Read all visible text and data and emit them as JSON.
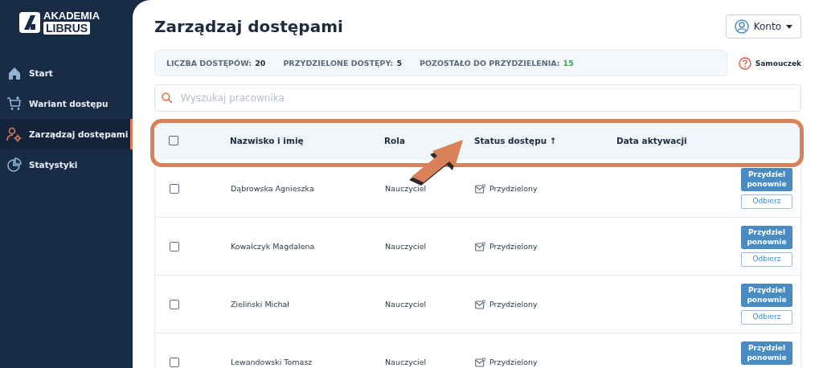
{
  "logo": {
    "line_1": "AKADEMIA",
    "line_2": "LIBRUS"
  },
  "sidebar": {
    "items": [
      {
        "label": "Start",
        "kind": "home",
        "selected": false
      },
      {
        "label": "Wariant dostępu",
        "kind": "cart",
        "selected": false
      },
      {
        "label": "Zarządzaj dostępami",
        "kind": "users",
        "selected": true
      },
      {
        "label": "Statystyki",
        "kind": "pie",
        "selected": false
      }
    ]
  },
  "page_title": "Zarządzaj dostępami",
  "account_button": "Konto",
  "stats": [
    {
      "label": "LICZBA DOSTĘPÓW:",
      "value": "20",
      "color": "#1c2b3e"
    },
    {
      "label": "PRZYDZIELONE DOSTĘPY:",
      "value": "5",
      "color": "#1c2b3e"
    },
    {
      "label": "POZOSTAŁO DO PRZYDZIELENIA:",
      "value": "15",
      "color": "#3fa34d"
    }
  ],
  "tutorial_link": "Samouczek",
  "search": {
    "placeholder": "Wyszukaj pracownika"
  },
  "table": {
    "select_all_checked": false,
    "columns": [
      "Nazwisko i imię",
      "Rola",
      "Status dostępu ↑",
      "Data aktywacji"
    ],
    "rows": [
      {
        "checked": false,
        "name": "Dąbrowska Agnieszka",
        "role": "Nauczyciel",
        "status": "Przydzielony",
        "buttons": [
          {
            "kind": "primary",
            "label": "Przydziel ponownie"
          },
          {
            "kind": "outline",
            "label": "Odbierz"
          }
        ]
      },
      {
        "checked": false,
        "name": "Kowalczyk Magdalena",
        "role": "Nauczyciel",
        "status": "Przydzielony",
        "buttons": [
          {
            "kind": "primary",
            "label": "Przydziel ponownie"
          },
          {
            "kind": "outline",
            "label": "Odbierz"
          }
        ]
      },
      {
        "checked": false,
        "name": "Zieliński Michał",
        "role": "Nauczyciel",
        "status": "Przydzielony",
        "buttons": [
          {
            "kind": "primary",
            "label": "Przydziel ponownie"
          },
          {
            "kind": "outline",
            "label": "Odbierz"
          }
        ]
      },
      {
        "checked": false,
        "name": "Lewandowski Tomasz",
        "role": "Nauczyciel",
        "status": "Przydzielony",
        "buttons": [
          {
            "kind": "primary",
            "label": "Przydziel ponownie"
          }
        ]
      }
    ]
  }
}
